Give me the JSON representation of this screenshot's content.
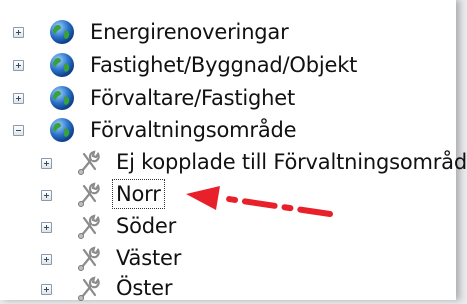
{
  "tree": {
    "nodes": [
      {
        "label": "Energirenoveringar",
        "icon": "globe-icon",
        "expander": "plus"
      },
      {
        "label": "Fastighet/Byggnad/Objekt",
        "icon": "globe-icon",
        "expander": "plus"
      },
      {
        "label": "Förvaltare/Fastighet",
        "icon": "globe-icon",
        "expander": "plus"
      },
      {
        "label": "Förvaltningsområde",
        "icon": "globe-icon",
        "expander": "minus",
        "children": [
          {
            "label": "Ej kopplade till Förvaltningsområde",
            "icon": "wrench-icon",
            "expander": "plus"
          },
          {
            "label": "Norr",
            "icon": "wrench-icon",
            "expander": "plus",
            "selected": true
          },
          {
            "label": "Söder",
            "icon": "wrench-icon",
            "expander": "plus"
          },
          {
            "label": "Väster",
            "icon": "wrench-icon",
            "expander": "plus"
          },
          {
            "label": "Öster",
            "icon": "wrench-icon",
            "expander": "plus"
          }
        ]
      }
    ]
  },
  "annotation": {
    "arrow_color": "#e8202a"
  }
}
